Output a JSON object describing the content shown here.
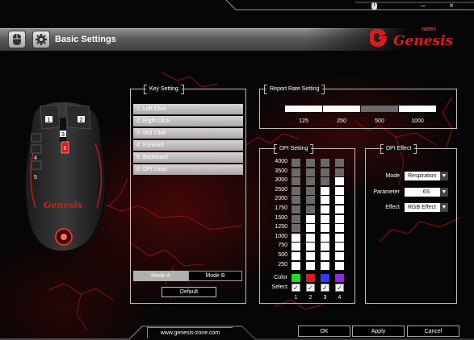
{
  "window": {
    "controls": {
      "logo": "mouse-icon",
      "minimize": "–",
      "close": "×"
    }
  },
  "header": {
    "title": "Basic Settings",
    "brand_small": "natec",
    "brand_name": "Genesis"
  },
  "key_setting": {
    "title": "Key Setting",
    "items": [
      {
        "num": "1",
        "label": "Left Click"
      },
      {
        "num": "2",
        "label": "Right Click"
      },
      {
        "num": "3",
        "label": "Mid Click"
      },
      {
        "num": "4",
        "label": "Forward"
      },
      {
        "num": "5",
        "label": "Backward"
      },
      {
        "num": "6",
        "label": "DPI Loop"
      }
    ],
    "mode_a": "Mode A",
    "mode_b": "Mode B",
    "active_mode": "Mode A",
    "default_button": "Default"
  },
  "report_rate": {
    "title": "Report Rate Setting",
    "options": [
      "125",
      "250",
      "500",
      "1000"
    ],
    "selected": "500"
  },
  "dpi": {
    "title": "DPI Setting",
    "levels": [
      "4000",
      "3500",
      "3000",
      "2500",
      "2000",
      "1750",
      "1500",
      "1250",
      "1000",
      "750",
      "500",
      "250"
    ],
    "columns": [
      {
        "num": "1",
        "color": "#1fdc1f",
        "value": "1000",
        "selected": true
      },
      {
        "num": "2",
        "color": "#e01818",
        "value": "1500",
        "selected": true
      },
      {
        "num": "3",
        "color": "#2a3cff",
        "value": "2500",
        "selected": true
      },
      {
        "num": "4",
        "color": "#8a2be2",
        "value": "3000",
        "selected": true
      }
    ],
    "color_label": "Color",
    "select_label": "Select",
    "check_glyph": "✓"
  },
  "dpi_effect": {
    "title": "DPI Effect",
    "mode_label": "Mode",
    "mode_value": "Respiration",
    "parameter_label": "Parameter",
    "parameter_value": "6S",
    "effect_label": "Effect",
    "effect_value": "RGB Effect",
    "dropdown_glyph": "▼"
  },
  "mouse_keys": {
    "k1": "1",
    "k2": "2",
    "k3": "3",
    "k4": "4",
    "k5": "5",
    "k6": "6",
    "logo": "Genesis"
  },
  "footer": {
    "url": "www.genesis-zone.com",
    "ok": "OK",
    "apply": "Apply",
    "cancel": "Cancel"
  },
  "colors": {
    "accent_red": "#d91c1c",
    "panel_border": "#bdbdbd",
    "dpi_on": "#ffffff",
    "dpi_off": "#6a6a6a"
  }
}
